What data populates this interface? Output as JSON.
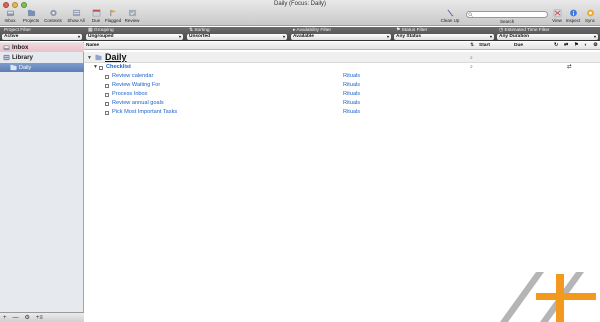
{
  "window": {
    "title": "Daily (Focus: Daily)"
  },
  "toolbar": {
    "left_buttons": [
      {
        "label": "Inbox"
      },
      {
        "label": "Projects"
      },
      {
        "label": "Contexts"
      },
      {
        "label": "Show All"
      },
      {
        "label": "Due"
      },
      {
        "label": "Flagged"
      },
      {
        "label": "Review"
      }
    ],
    "cleanup_label": "Clean Up",
    "search_label": "Search",
    "search_placeholder": "",
    "right_buttons": [
      {
        "label": "View"
      },
      {
        "label": "Inspect"
      },
      {
        "label": "Sync"
      }
    ]
  },
  "filters": [
    {
      "title": "Project Filter",
      "value": "Active"
    },
    {
      "title": "Grouping",
      "value": "Ungrouped"
    },
    {
      "title": "Sorting",
      "value": "Unsorted"
    },
    {
      "title": "Availability Filter",
      "value": "Available"
    },
    {
      "title": "Status Filter",
      "value": "Any Status"
    },
    {
      "title": "Estimated Time Filter",
      "value": "Any Duration"
    }
  ],
  "sidebar": {
    "items": [
      {
        "label": "Inbox"
      },
      {
        "label": "Library"
      },
      {
        "label": "Daily"
      }
    ],
    "bottom_controls": [
      "+",
      "—",
      "⚙",
      "+≡"
    ]
  },
  "outline": {
    "columns": {
      "name": "Name",
      "start": "Start",
      "due": "Due"
    },
    "folder": {
      "name": "Daily"
    },
    "heading": {
      "name": "Checklist"
    },
    "actions": [
      {
        "name": "Review calendar",
        "context": "Rituals"
      },
      {
        "name": "Review Waiting For",
        "context": "Rituals"
      },
      {
        "name": "Process Inbox",
        "context": "Rituals"
      },
      {
        "name": "Review annual goals",
        "context": "Rituals"
      },
      {
        "name": "Pick Most Important Tasks",
        "context": "Rituals"
      }
    ]
  },
  "colors": {
    "accent_link": "#1a63c9",
    "selected_sidebar": "#5d7fb7",
    "inbox_highlight": "#e8c2c9",
    "logo_orange": "#f39a1e",
    "logo_gray": "#9a9a9a"
  }
}
